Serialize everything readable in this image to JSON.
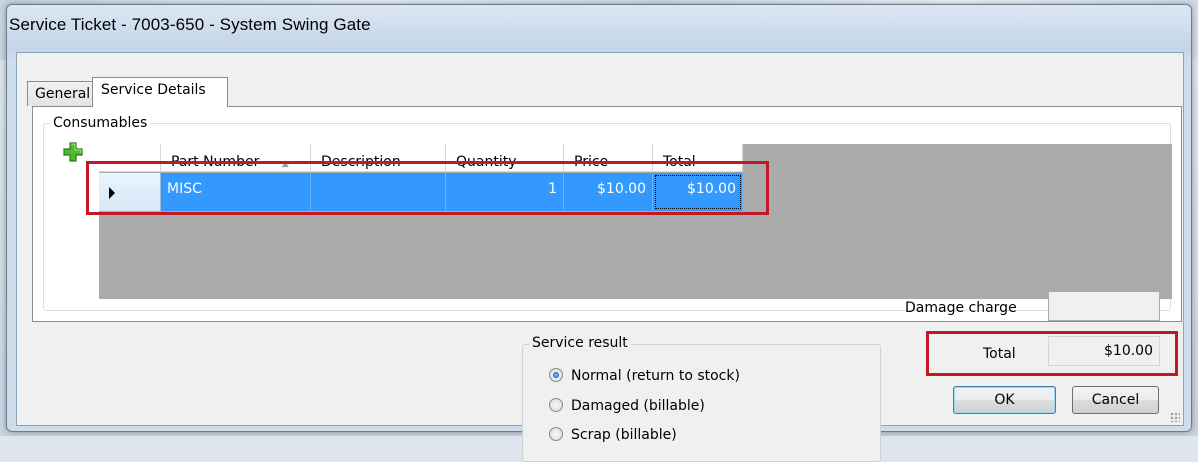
{
  "window": {
    "title": "Service Ticket - 7003-650 - System Swing Gate"
  },
  "tabs": [
    {
      "label": "General",
      "active": false
    },
    {
      "label": "Service Details",
      "active": true
    }
  ],
  "consumables": {
    "legend": "Consumables",
    "add_icon": "add-icon",
    "columns": [
      "Part Number",
      "Description",
      "Quantity",
      "Price",
      "Total"
    ],
    "sort_indicator": "▲",
    "rows": [
      {
        "part_number": "MISC",
        "description": "",
        "quantity": "1",
        "price": "$10.00",
        "total": "$10.00"
      }
    ]
  },
  "service_result": {
    "legend": "Service result",
    "options": [
      {
        "label": "Normal (return to stock)",
        "selected": true
      },
      {
        "label": "Damaged (billable)",
        "selected": false
      },
      {
        "label": "Scrap (billable)",
        "selected": false
      }
    ]
  },
  "charges": {
    "damage_label": "Damage charge",
    "damage_value": "",
    "total_label": "Total",
    "total_value": "$10.00"
  },
  "buttons": {
    "ok": "OK",
    "cancel": "Cancel"
  },
  "colors": {
    "selection": "#3399ff",
    "highlight_box": "#c11a24"
  }
}
